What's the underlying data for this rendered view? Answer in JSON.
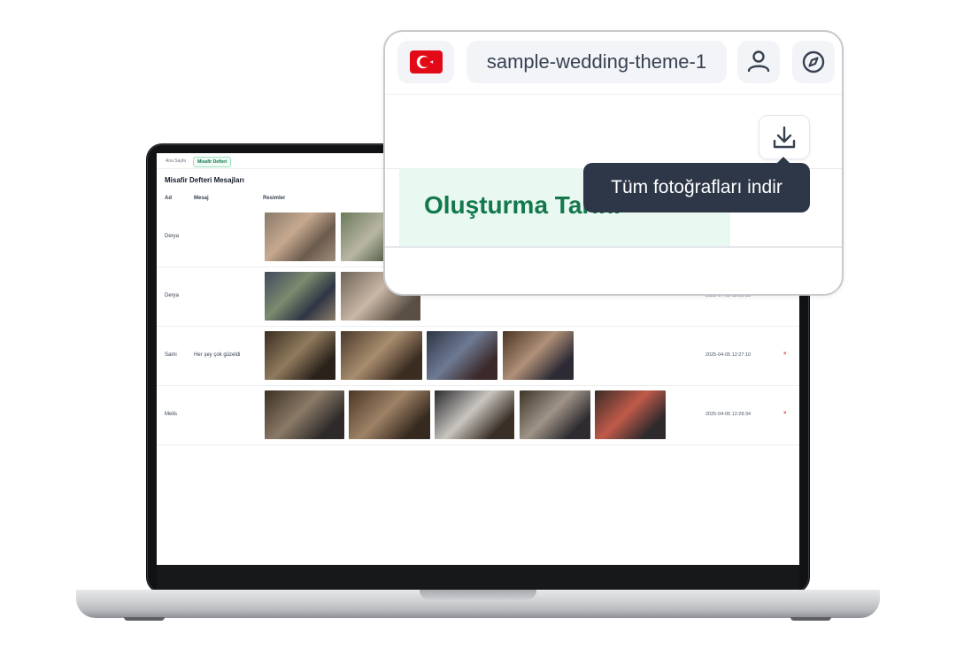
{
  "app": {
    "tabs": [
      {
        "label": "Ana Sayfa",
        "active": false
      },
      {
        "label": "Misafir Defteri",
        "active": true
      }
    ],
    "title": "Misafir Defteri Mesajları",
    "columns": {
      "ad": "Ad",
      "mesaj": "Mesaj",
      "resimler": "Resimler"
    },
    "rows": [
      {
        "name": "Derya",
        "message": "",
        "date": "",
        "photo_count": 2
      },
      {
        "name": "Derya",
        "message": "",
        "date": "2025-04-05 12:25:16",
        "photo_count": 2
      },
      {
        "name": "Sami",
        "message": "Her şey çok güzeldi",
        "date": "2025-04-05 12:27:10",
        "photo_count": 4
      },
      {
        "name": "Melis",
        "message": "",
        "date": "2025-04-05 12:28:34",
        "photo_count": 5
      }
    ],
    "delete_symbol": "×"
  },
  "zoom": {
    "language_flag": "turkey-flag-icon",
    "site_name": "sample-wedding-theme-1",
    "user_icon": "user-icon",
    "compass_icon": "compass-icon",
    "download_icon": "download-icon",
    "tooltip": "Tüm fotoğrafları indir",
    "heading": "Oluşturma Tarihi"
  },
  "colors": {
    "accent_green": "#13784c",
    "accent_bg": "#e9f9f1",
    "tooltip_bg": "#2d3748",
    "flag_red": "#e30a17",
    "delete_red": "#e03a3a"
  }
}
